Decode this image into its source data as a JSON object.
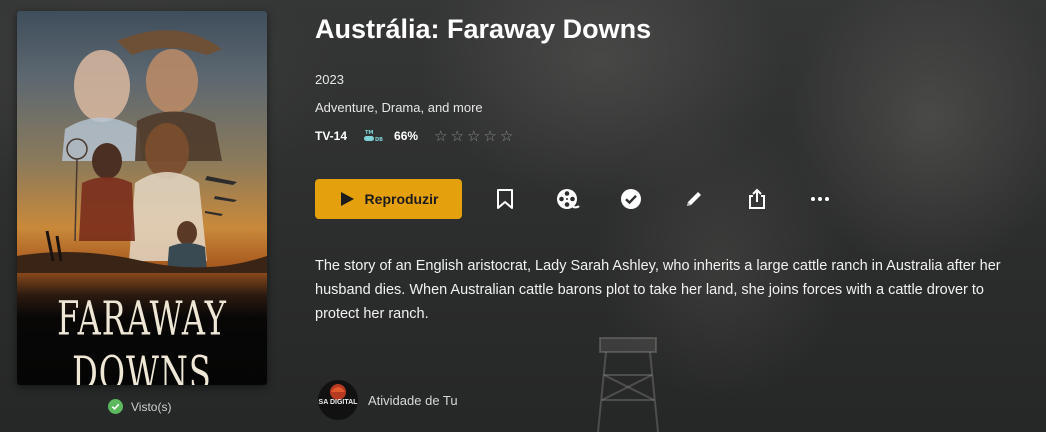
{
  "poster": {
    "title_art": "FARAWAY DOWNS",
    "watched_label": "Visto(s)"
  },
  "title": "Austrália: Faraway Downs",
  "year": "2023",
  "genres": "Adventure, Drama, and more",
  "ratings": {
    "content_rating": "TV-14",
    "critic_icon": "rotten-tomatoes-critic-icon",
    "critic_score": "66%",
    "user_rating_stars": 0,
    "user_rating_max": 5
  },
  "actions": {
    "play_label": "Reproduzir",
    "icons": [
      "bookmark-icon",
      "film-reel-icon",
      "check-circle-icon",
      "pencil-icon",
      "share-icon",
      "more-icon"
    ]
  },
  "summary": "The story of an English aristocrat, Lady Sarah Ashley, who inherits a large cattle ranch in Australia after her husband dies. When Australian cattle barons plot to take her land, she joins forces with a cattle drover to protect her ranch.",
  "activity": {
    "avatar_text": "SA DIGITAL",
    "label": "Atividade de Tu"
  },
  "colors": {
    "accent": "#e5a00d",
    "background": "#2a2b2b",
    "watched_green": "#5cb85c"
  }
}
